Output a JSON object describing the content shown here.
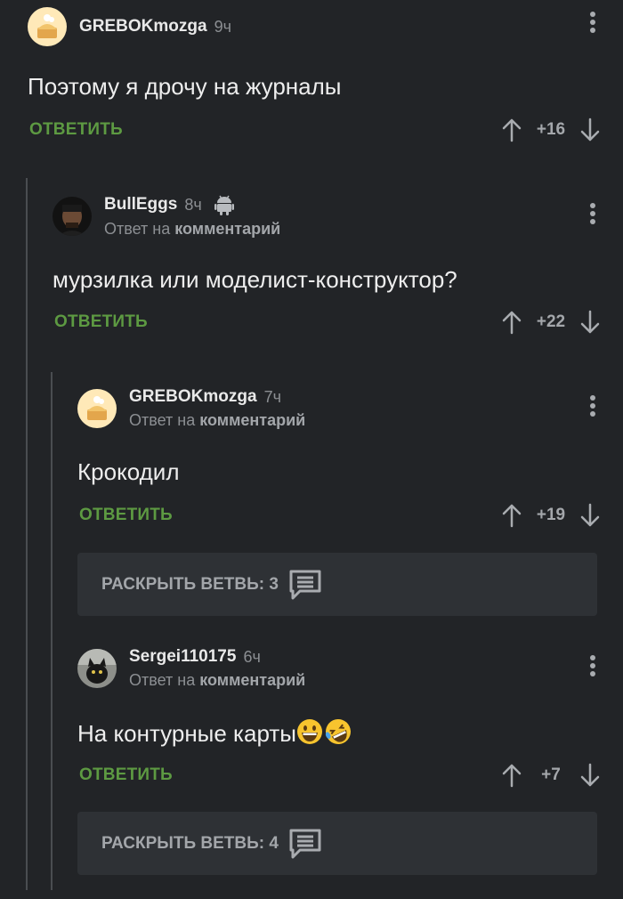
{
  "comments": [
    {
      "username": "GREBOKmozga",
      "time": "9ч",
      "text": "Поэтому я дрочу на журналы",
      "reply_label": "ОТВЕТИТЬ",
      "score": "+16"
    },
    {
      "username": "BullEggs",
      "time": "8ч",
      "reply_to_prefix": "Ответ на",
      "reply_to_link": "комментарий",
      "text": "мурзилка или моделист-конструктор?",
      "reply_label": "ОТВЕТИТЬ",
      "score": "+22",
      "os_icon": "android-icon"
    },
    {
      "username": "GREBOKmozga",
      "time": "7ч",
      "reply_to_prefix": "Ответ на",
      "reply_to_link": "комментарий",
      "text": "Крокодил",
      "reply_label": "ОТВЕТИТЬ",
      "score": "+19"
    },
    {
      "username": "Sergei110175",
      "time": "6ч",
      "reply_to_prefix": "Ответ на",
      "reply_to_link": "комментарий",
      "text": "На контурные карты",
      "emojis": [
        "grinning-face-emoji",
        "rolling-on-floor-laughing-emoji"
      ],
      "reply_label": "ОТВЕТИТЬ",
      "score": "+7"
    }
  ],
  "expand_branches": [
    {
      "label": "РАСКРЫТЬ ВЕТВЬ: 3",
      "icon": "comments-icon"
    },
    {
      "label": "РАСКРЫТЬ ВЕТВЬ: 4",
      "icon": "comments-icon"
    }
  ],
  "icons": {
    "upvote": "arrow-up-icon",
    "downvote": "arrow-down-icon",
    "menu": "more-vertical-icon"
  },
  "colors": {
    "background": "#222427",
    "accent_green": "#5d9a42",
    "muted_text": "#8c8f93",
    "panel": "#2e3135"
  }
}
